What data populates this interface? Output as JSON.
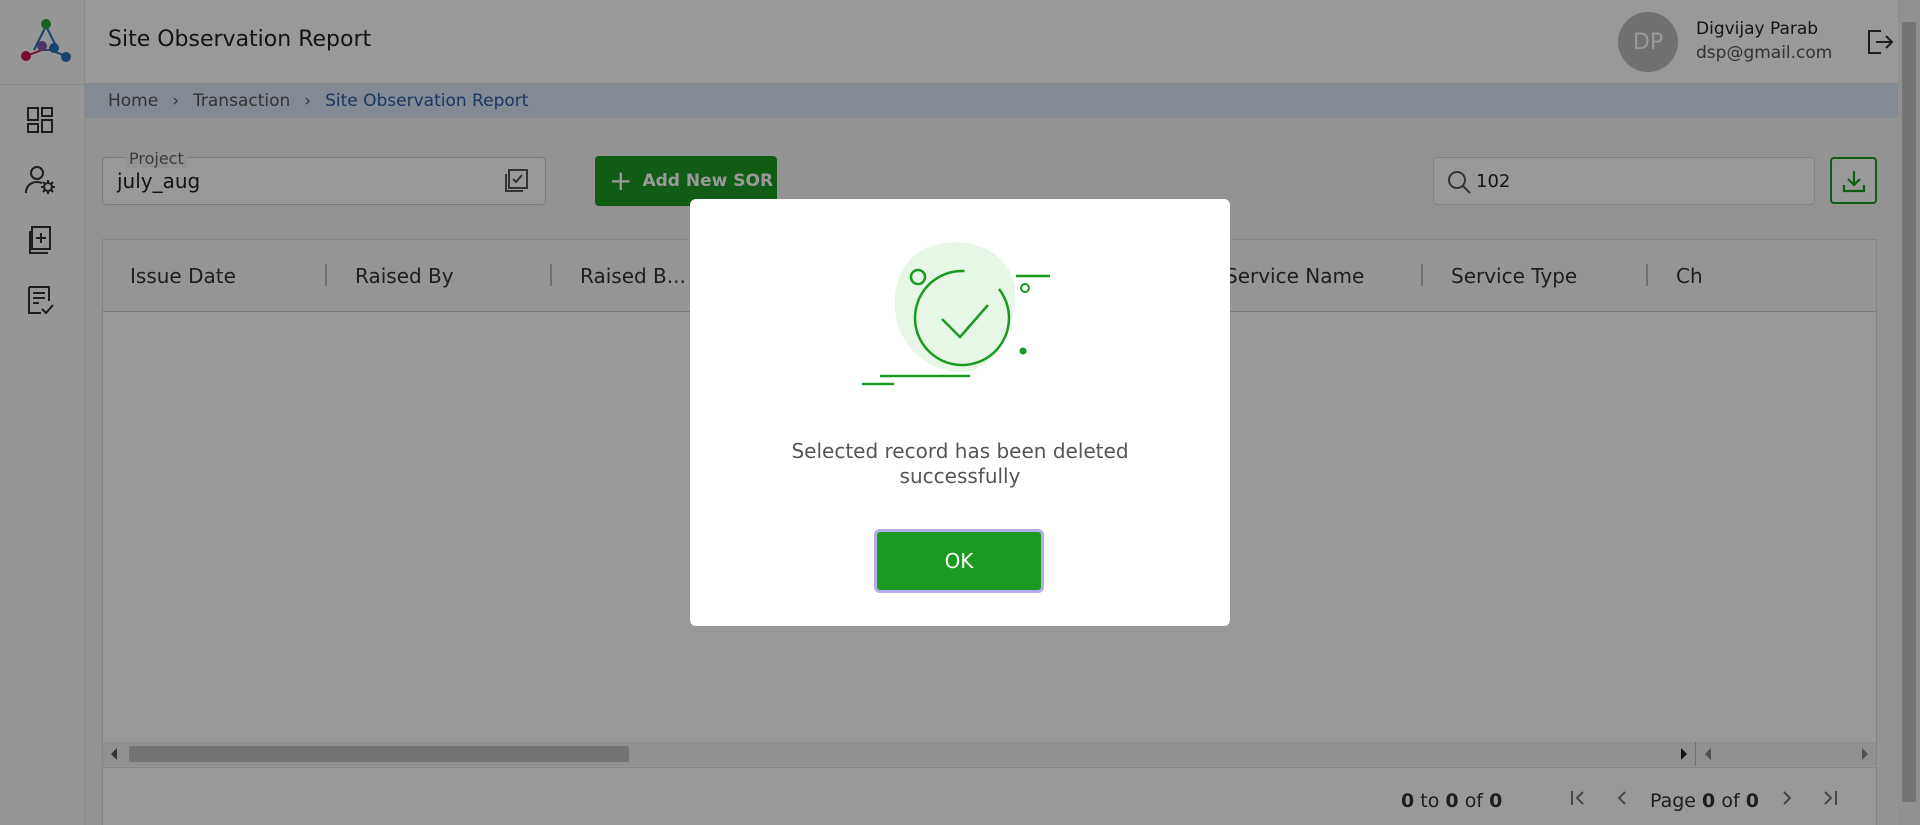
{
  "header": {
    "title": "Site Observation Report",
    "avatar_initials": "DP",
    "user_name": "Digvijay Parab",
    "user_email": "dsp@gmail.com"
  },
  "sidebar": {
    "items": [
      {
        "icon": "dashboard-icon"
      },
      {
        "icon": "user-settings-icon"
      },
      {
        "icon": "add-document-icon"
      },
      {
        "icon": "report-check-icon"
      }
    ]
  },
  "breadcrumb": [
    "Home",
    "Transaction",
    "Site Observation Report"
  ],
  "toolbar": {
    "project_label": "Project",
    "project_value": "july_aug",
    "add_button_label": "Add New SOR",
    "search_value": "102"
  },
  "grid": {
    "columns": [
      "Issue Date",
      "Raised By",
      "Raised B...",
      "Service Name",
      "Service Type",
      "Ch"
    ],
    "pagination": {
      "from": "0",
      "to_word": "to",
      "to": "0",
      "of_word": "of",
      "total": "0",
      "page_word": "Page",
      "page": "0",
      "pages": "0"
    }
  },
  "modal": {
    "message": "Selected record has been deleted successfully",
    "ok_label": "OK"
  },
  "colors": {
    "primary_green": "#1b9a22",
    "breadcrumb_bg": "#dde6f5",
    "link_blue": "#2c5aa0"
  }
}
